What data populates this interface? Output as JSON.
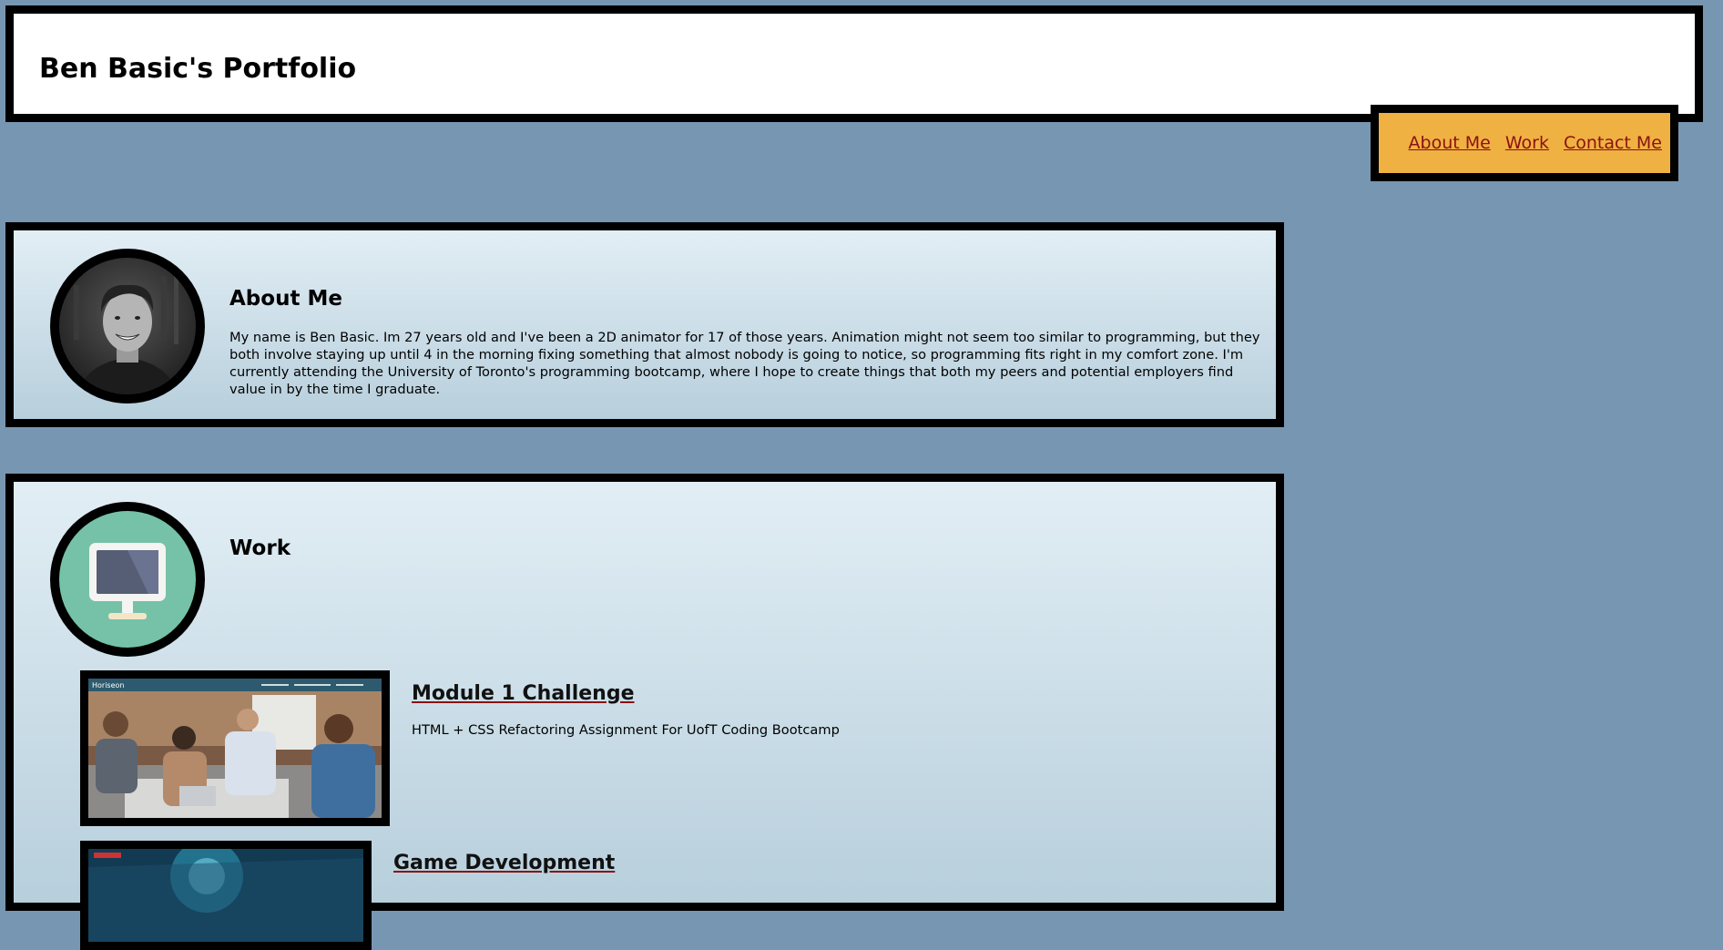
{
  "header": {
    "title": "Ben Basic's Portfolio"
  },
  "nav": {
    "items": [
      {
        "label": "About Me"
      },
      {
        "label": "Work"
      },
      {
        "label": "Contact Me"
      }
    ]
  },
  "about": {
    "heading": "About Me",
    "text": "My name is Ben Basic. Im 27 years old and I've been a 2D animator for 17 of those years. Animation might not seem too similar to programming, but they both involve staying up until 4 in the morning fixing something that almost nobody is going to notice, so programming fits right in my comfort zone. I'm currently attending the University of Toronto's programming bootcamp, where I hope to create things that both my peers and potential employers find value in by the time I graduate.",
    "avatar_icon": "portrait-photo"
  },
  "work": {
    "heading": "Work",
    "icon": "computer-monitor-icon",
    "projects": [
      {
        "title": "Module 1 Challenge",
        "description": "HTML + CSS Refactoring Assignment For UofT Coding Bootcamp",
        "thumb_brand": "Horiseon"
      },
      {
        "title": "Game Development",
        "description": ""
      }
    ]
  },
  "colors": {
    "page_background": "#7796b2",
    "nav_background": "#f0b143",
    "link": "#8a1212",
    "border": "#000000"
  }
}
